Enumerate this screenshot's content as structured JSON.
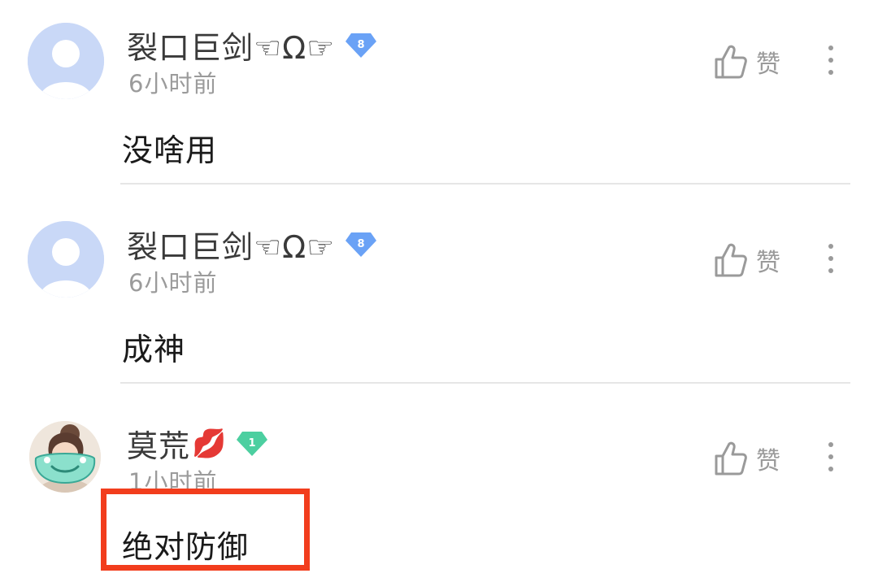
{
  "comments": [
    {
      "author": "裂口巨剑☜Ω☞",
      "level": "8",
      "time": "6小时前",
      "text": "没啥用",
      "like_label": "赞",
      "avatar": "default-avatar",
      "badge_color": "#6aa2f6"
    },
    {
      "author": "裂口巨剑☜Ω☞",
      "level": "8",
      "time": "6小时前",
      "text": "成神",
      "like_label": "赞",
      "avatar": "default-avatar",
      "badge_color": "#6aa2f6"
    },
    {
      "author": "莫荒",
      "author_emoji": "💋",
      "level": "1",
      "time": "1小时前",
      "text": "绝对防御",
      "like_label": "赞",
      "avatar": "character-avatar",
      "badge_color": "#4ccfa0"
    }
  ],
  "colors": {
    "highlight": "#f23d1d",
    "divider": "#e6e6e6",
    "icon_gray": "#9a9a9a"
  }
}
